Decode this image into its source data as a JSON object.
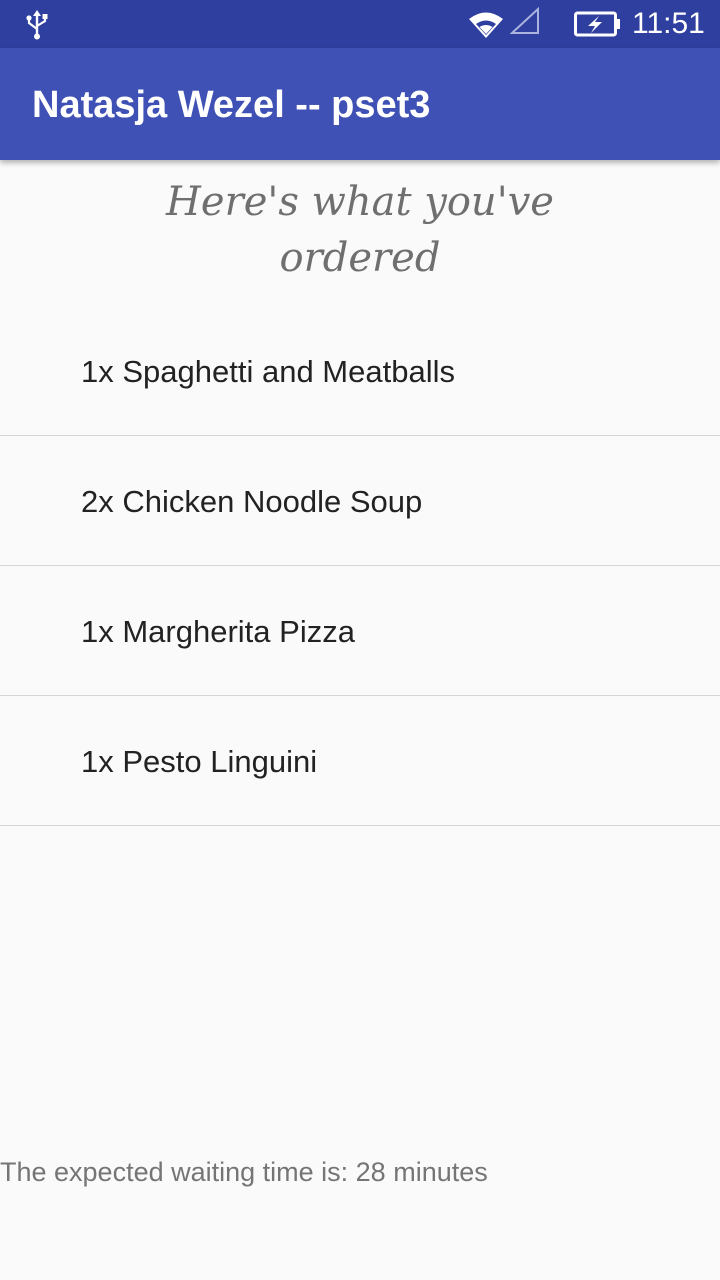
{
  "status_bar": {
    "time": "11:51",
    "icons": [
      "usb-icon",
      "wifi-icon",
      "signal-icon",
      "battery-charging-icon"
    ]
  },
  "app_bar": {
    "title": "Natasja Wezel -- pset3"
  },
  "heading": {
    "line1": "Here's what you've",
    "line2": "ordered"
  },
  "orders": [
    {
      "label": "1x Spaghetti and Meatballs"
    },
    {
      "label": "2x Chicken Noodle Soup"
    },
    {
      "label": "1x Margherita Pizza"
    },
    {
      "label": "1x Pesto Linguini"
    }
  ],
  "footer": {
    "waiting_text": "The expected waiting time is: 28 minutes"
  },
  "colors": {
    "status_bar": "#2f3f9f",
    "app_bar": "#3f51b5",
    "background": "#fafafa",
    "divider": "#d6d6d6"
  }
}
